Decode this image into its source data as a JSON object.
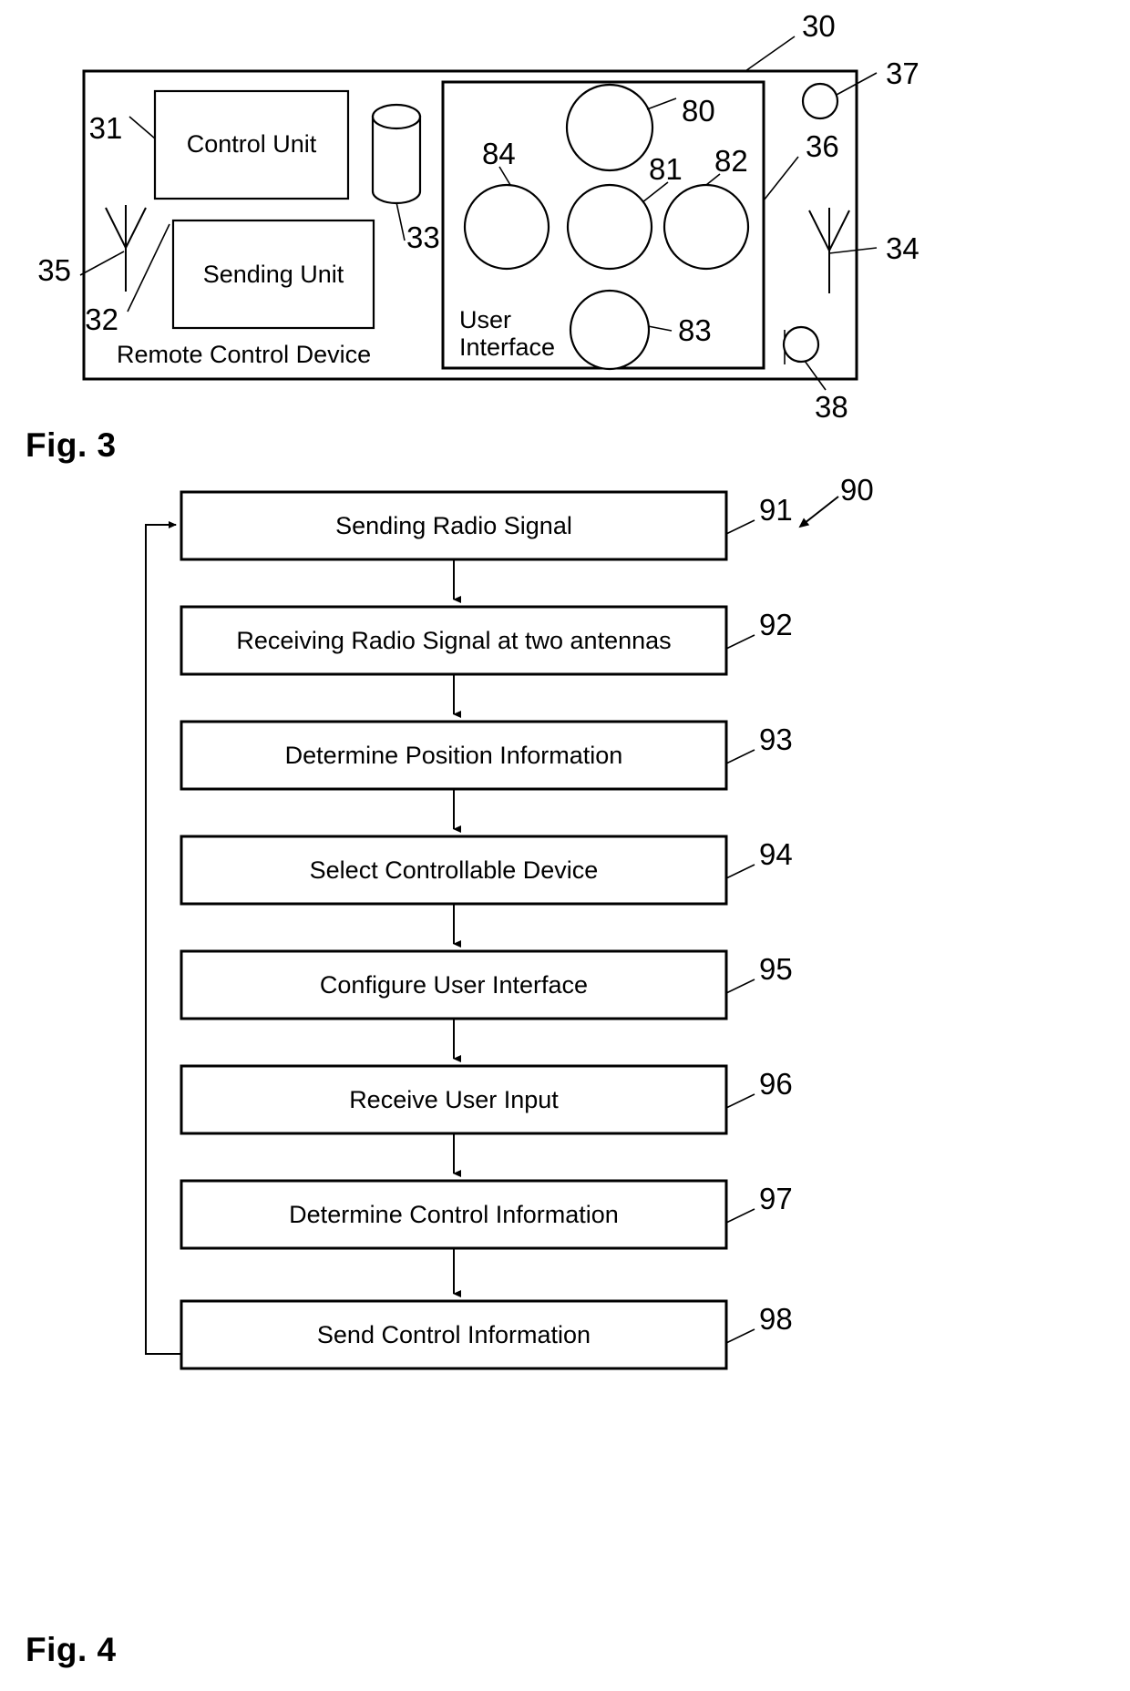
{
  "document": {
    "type": "patent-drawing-sheet",
    "figures": [
      {
        "caption": "Fig. 3"
      },
      {
        "caption": "Fig. 4"
      }
    ]
  },
  "fig3": {
    "caption": "Fig. 3",
    "outer_ref": "30",
    "device_label": "Remote Control Device",
    "blocks": [
      {
        "label": "Control Unit",
        "ref": "31"
      },
      {
        "label": "Sending Unit",
        "ref": "32"
      }
    ],
    "storage": {
      "ref": "33",
      "icon": "cylinder-database-icon"
    },
    "antennas": [
      {
        "ref": "35",
        "side": "left",
        "icon": "antenna-icon"
      },
      {
        "ref": "34",
        "side": "right",
        "icon": "antenna-icon"
      }
    ],
    "user_interface": {
      "label_line1": "User",
      "label_line2": "Interface",
      "ref": "36",
      "buttons": [
        {
          "ref": "80",
          "size": "large"
        },
        {
          "ref": "84",
          "size": "large"
        },
        {
          "ref": "81",
          "size": "large"
        },
        {
          "ref": "82",
          "size": "large"
        },
        {
          "ref": "83",
          "size": "large"
        }
      ]
    },
    "indicators": [
      {
        "ref": "37",
        "position": "top-right",
        "icon": "indicator-circle-icon"
      },
      {
        "ref": "38",
        "position": "bottom-right",
        "icon": "indicator-circle-icon"
      }
    ]
  },
  "fig4": {
    "caption": "Fig. 4",
    "method_ref": "90",
    "steps": [
      {
        "ref": "91",
        "label": "Sending Radio Signal"
      },
      {
        "ref": "92",
        "label": "Receiving Radio Signal at two antennas"
      },
      {
        "ref": "93",
        "label": "Determine Position Information"
      },
      {
        "ref": "94",
        "label": "Select Controllable Device"
      },
      {
        "ref": "95",
        "label": "Configure User Interface"
      },
      {
        "ref": "96",
        "label": "Receive User Input"
      },
      {
        "ref": "97",
        "label": "Determine Control Information"
      },
      {
        "ref": "98",
        "label": "Send Control Information"
      }
    ],
    "feedback_loop": {
      "from": "98",
      "to": "91"
    }
  },
  "colors": {
    "ink": "#000000",
    "background": "#ffffff"
  }
}
